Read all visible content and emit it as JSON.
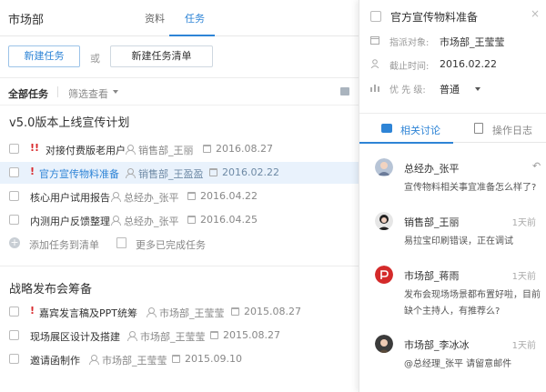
{
  "header": {
    "dept": "市场部",
    "tabs": [
      "资料",
      "任务"
    ]
  },
  "actions": {
    "new_task": "新建任务",
    "or": "或",
    "new_list": "新建任务清单"
  },
  "filter": {
    "all": "全部任务",
    "filter_label": "筛选查看"
  },
  "groups": [
    {
      "title": "v5.0版本上线宣传计划",
      "tasks": [
        {
          "prio": "!!",
          "title": "对接付费版老用户",
          "owner": "销售部_王丽",
          "date": "2016.08.27"
        },
        {
          "prio": "!",
          "title": "官方宣传物料准备",
          "owner": "销售部_王盈盈",
          "date": "2016.02.22"
        },
        {
          "prio": "",
          "title": "核心用户试用报告",
          "owner": "总经办_张平",
          "date": "2016.04.22"
        },
        {
          "prio": "",
          "title": "内测用户反馈整理",
          "owner": "总经办_张平",
          "date": "2016.04.25"
        }
      ],
      "add_label": "添加任务到清单",
      "more_done": "更多已完成任务"
    },
    {
      "title": "战略发布会筹备",
      "tasks": [
        {
          "prio": "!",
          "title": "嘉宾发言稿及PPT统筹",
          "owner": "市场部_王莹莹",
          "date": "2015.08.27"
        },
        {
          "prio": "",
          "title": "现场展区设计及搭建",
          "owner": "市场部_王莹莹",
          "date": "2015.08.27"
        },
        {
          "prio": "",
          "title": "邀请函制作",
          "owner": "市场部_王莹莹",
          "date": "2015.09.10"
        }
      ]
    }
  ],
  "detail": {
    "title": "官方宣传物料准备",
    "close": "×",
    "assignee_label": "指派对象:",
    "assignee": "市场部_王莹莹",
    "deadline_label": "截止时间:",
    "deadline": "2016.02.22",
    "priority_label": "优 先 级:",
    "priority": "普通",
    "tabs": [
      "相关讨论",
      "操作日志"
    ],
    "comments": [
      {
        "name": "总经办_张平",
        "time": "",
        "text": "宣传物料相关事宜准备怎么样了?"
      },
      {
        "name": "销售部_王丽",
        "time": "1天前",
        "text": "易拉宝印刷错误，正在调试"
      },
      {
        "name": "市场部_蒋雨",
        "time": "1天前",
        "text": "发布会现场场景都布置好啦，目前缺个主持人，有推荐么?"
      },
      {
        "name": "市场部_李冰冰",
        "time": "1天前",
        "text": "@总经理_张平  请留意邮件"
      }
    ]
  },
  "colors": {
    "accent": "#2e84d6",
    "priority": "#d9292c"
  }
}
